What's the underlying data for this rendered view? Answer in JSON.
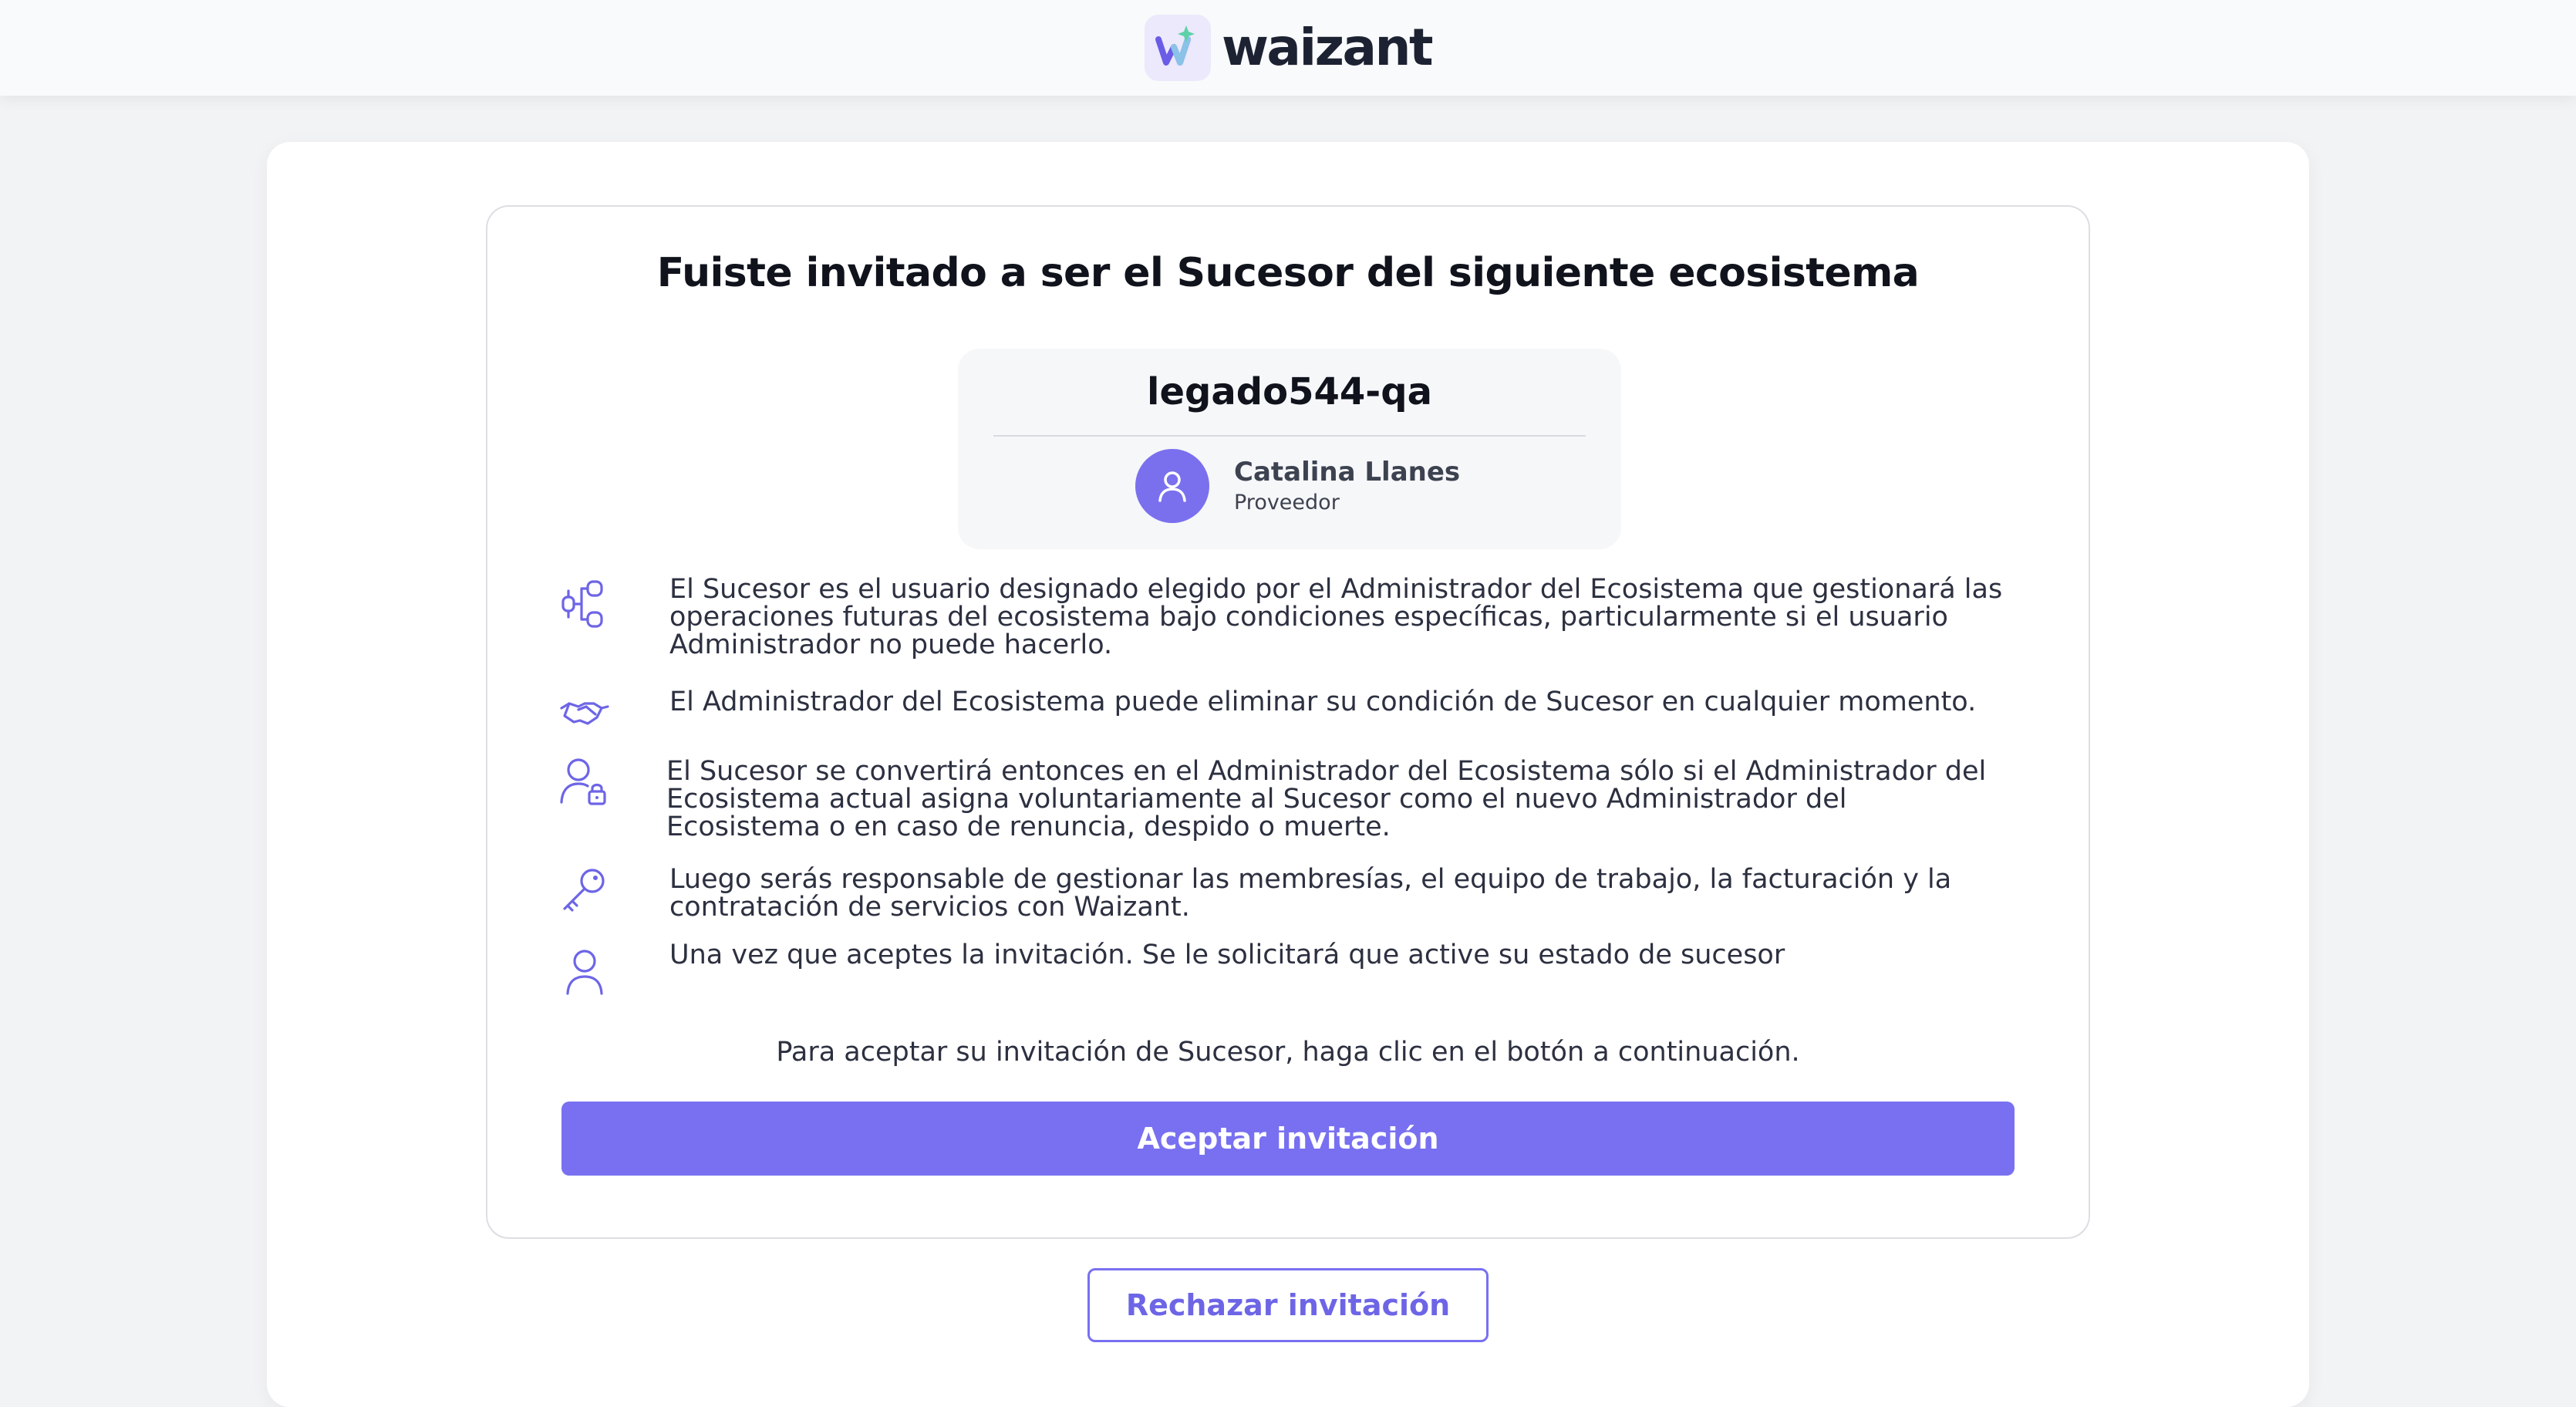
{
  "header": {
    "logo_icon": "waizant-logo-icon",
    "logo_text": "waizant"
  },
  "invitation": {
    "title": "Fuiste invitado a ser el Sucesor del siguiente ecosistema",
    "ecosystem_name": "legado544-qa",
    "user": {
      "name": "Catalina Llanes",
      "role": "Proveedor",
      "avatar_icon": "user-icon"
    },
    "features": [
      {
        "icon": "hierarchy-icon",
        "text": "El Sucesor es el usuario designado elegido por el Administrador del Ecosistema que gestionará las operaciones futuras del ecosistema bajo condiciones específicas, particularmente si el usuario Administrador no puede hacerlo."
      },
      {
        "icon": "handshake-icon",
        "text": "El Administrador del Ecosistema puede eliminar su condición de Sucesor en cualquier momento."
      },
      {
        "icon": "user-lock-icon",
        "text": "El Sucesor se convertirá entonces en el Administrador del Ecosistema sólo si el Administrador del Ecosistema actual asigna voluntariamente al Sucesor como el nuevo Administrador del Ecosistema o en caso de renuncia, despido o muerte."
      },
      {
        "icon": "key-icon",
        "text": "Luego serás responsable de gestionar las membresías, el equipo de trabajo, la facturación y la contratación de servicios con Waizant."
      },
      {
        "icon": "user-icon",
        "text": "Una vez que aceptes la invitación. Se le solicitará que active su estado de sucesor"
      }
    ],
    "accept_note": "Para aceptar su invitación de Sucesor, haga clic en el botón a continuación.",
    "accept_label": "Aceptar invitación",
    "reject_label": "Rechazar invitación"
  },
  "colors": {
    "accent": "#7870f0",
    "background": "#f2f3f5",
    "card": "#ffffff"
  }
}
